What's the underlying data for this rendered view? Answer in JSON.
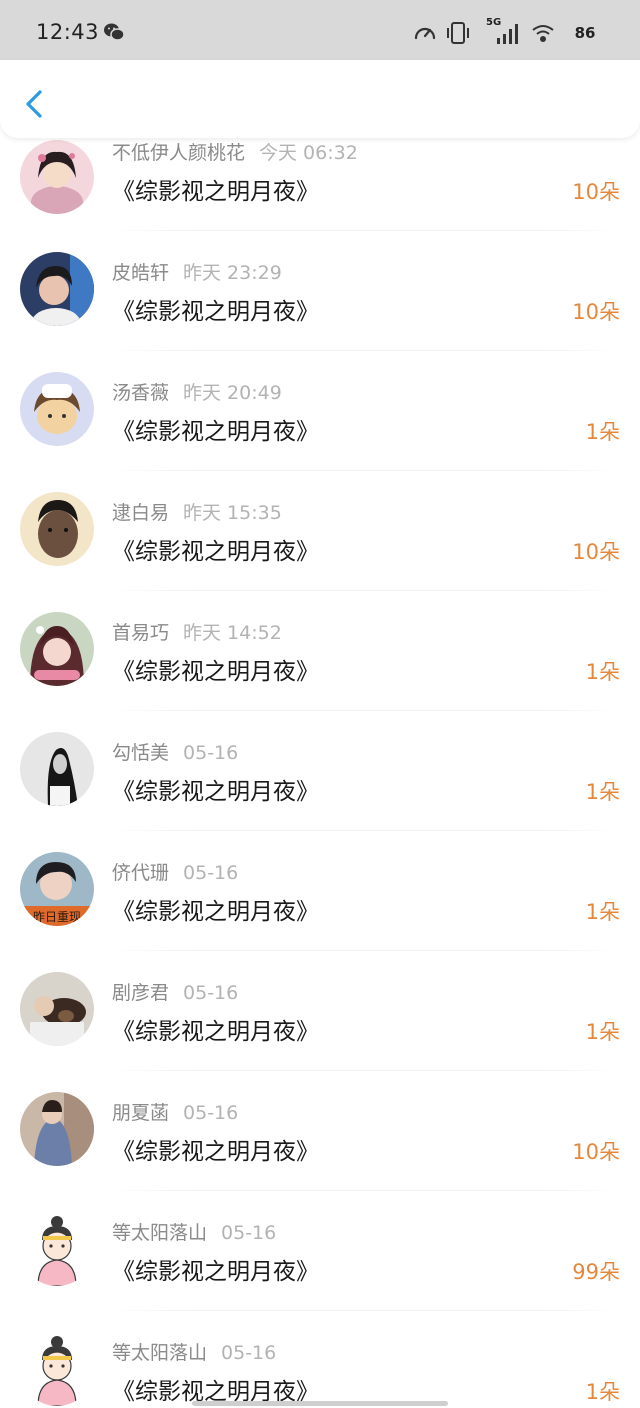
{
  "status_bar": {
    "time": "12:43",
    "network": "5G",
    "battery": "86"
  },
  "header": {
    "back_icon": "chevron-left-icon",
    "accent_color": "#2a9be0"
  },
  "colors": {
    "count": "#e6873a",
    "title": "#1a1a1a",
    "name": "#8a8a8a",
    "time": "#b3b3b3"
  },
  "rows": [
    {
      "name": "不低伊人颜桃花",
      "time": "今天 06:32",
      "title": "《综影视之明月夜》",
      "count": "10朵"
    },
    {
      "name": "皮皓轩",
      "time": "昨天 23:29",
      "title": "《综影视之明月夜》",
      "count": "10朵"
    },
    {
      "name": "汤香薇",
      "time": "昨天 20:49",
      "title": "《综影视之明月夜》",
      "count": "1朵"
    },
    {
      "name": "逮白易",
      "time": "昨天 15:35",
      "title": "《综影视之明月夜》",
      "count": "10朵"
    },
    {
      "name": "首易巧",
      "time": "昨天 14:52",
      "title": "《综影视之明月夜》",
      "count": "1朵"
    },
    {
      "name": "勾恬美",
      "time": "05-16",
      "title": "《综影视之明月夜》",
      "count": "1朵"
    },
    {
      "name": "侪代珊",
      "time": "05-16",
      "title": "《综影视之明月夜》",
      "count": "1朵"
    },
    {
      "name": "剧彦君",
      "time": "05-16",
      "title": "《综影视之明月夜》",
      "count": "1朵"
    },
    {
      "name": "朋夏菡",
      "time": "05-16",
      "title": "《综影视之明月夜》",
      "count": "10朵"
    },
    {
      "name": "等太阳落山",
      "time": "05-16",
      "title": "《综影视之明月夜》",
      "count": "99朵"
    },
    {
      "name": "等太阳落山",
      "time": "05-16",
      "title": "《综影视之明月夜》",
      "count": "1朵"
    }
  ],
  "avatar_overlay_text": "昨日重现"
}
